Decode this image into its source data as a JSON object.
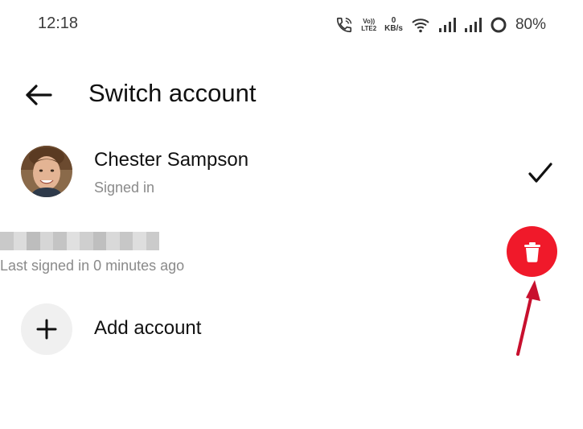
{
  "status_bar": {
    "time": "12:18",
    "volte_top": "Vo))",
    "volte_bottom": "LTE2",
    "speed_value": "0",
    "speed_unit": "KB/s",
    "battery": "80%"
  },
  "header": {
    "title": "Switch account"
  },
  "accounts": [
    {
      "name": "Chester Sampson",
      "status": "Signed in",
      "selected": true
    },
    {
      "name_redacted": true,
      "status": "Last signed in 0 minutes ago"
    }
  ],
  "add_account": {
    "label": "Add account"
  },
  "colors": {
    "accent_red": "#f0192a",
    "annotation_arrow": "#c8102e",
    "muted_text": "#8a8a8a"
  },
  "icons": {
    "back": "arrow-left-icon",
    "check": "check-icon",
    "trash": "trash-icon",
    "add": "plus-icon"
  }
}
